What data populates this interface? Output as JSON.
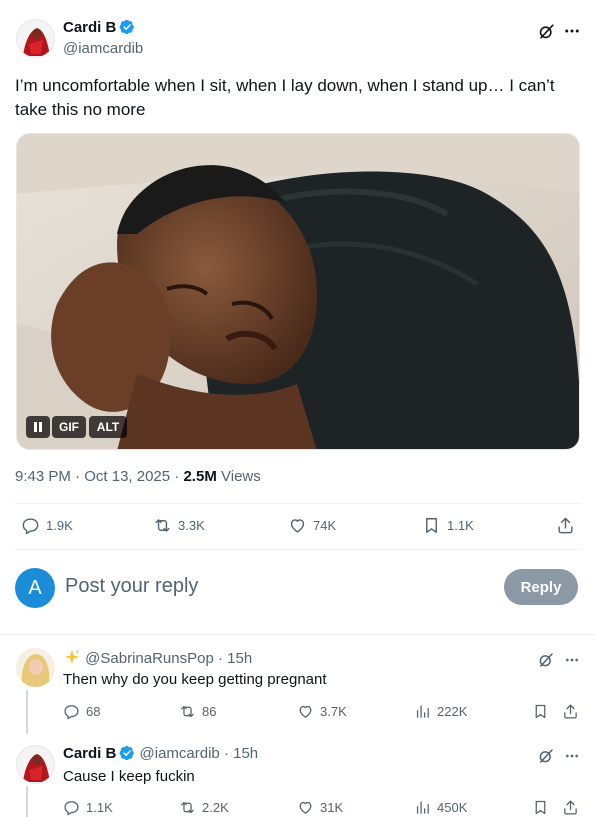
{
  "tweet": {
    "author_name": "Cardi B",
    "author_handle": "@iamcardib",
    "text": "I’m uncomfortable when I sit, when I lay down, when I stand up… I can’t take this no more",
    "media": {
      "badge_gif": "GIF",
      "badge_alt": "ALT"
    },
    "time": "9:43 PM",
    "sep1": "·",
    "date": "Oct 13, 2025",
    "sep2": "·",
    "views_count": "2.5M",
    "views_label": "Views",
    "stats": {
      "replies": "1.9K",
      "retweets": "3.3K",
      "likes": "74K",
      "bookmarks": "1.1K"
    }
  },
  "composer": {
    "avatar_letter": "A",
    "placeholder": "Post your reply",
    "reply_button": "Reply"
  },
  "replies": [
    {
      "handle": "@SabrinaRunsPop",
      "sep": "·",
      "time": "15h",
      "text": "Then why do you keep getting pregnant",
      "stats": {
        "replies": "68",
        "retweets": "86",
        "likes": "3.7K",
        "views": "222K"
      }
    },
    {
      "author_name": "Cardi B",
      "handle": "@iamcardib",
      "sep": "·",
      "time": "15h",
      "text": "Cause I keep fuckin",
      "stats": {
        "replies": "1.1K",
        "retweets": "2.2K",
        "likes": "31K",
        "views": "450K"
      }
    }
  ],
  "colors": {
    "accent": "#1d9bf0",
    "composer_avatar": "#1a8cd8",
    "reply_button_bg": "#8b98a5",
    "text": "#0f1419",
    "muted": "#536471"
  },
  "icons": [
    "verified-badge-icon",
    "grok-icon",
    "more-icon",
    "reply-icon",
    "retweet-icon",
    "like-icon",
    "bookmark-icon",
    "share-icon",
    "views-icon",
    "pause-icon",
    "sparkle-icon"
  ]
}
